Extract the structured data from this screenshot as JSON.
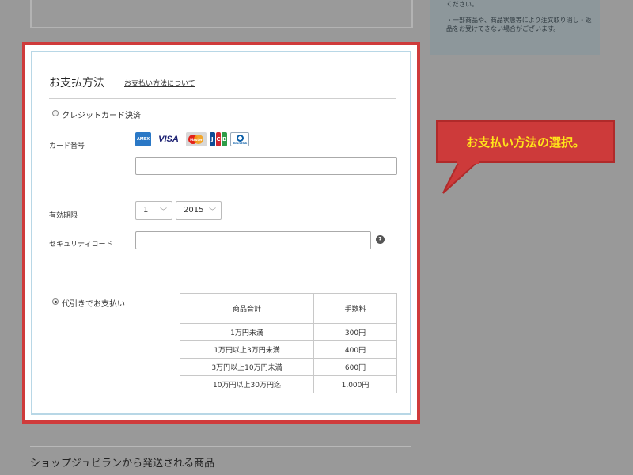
{
  "sidebar_note": {
    "line1": "ください。",
    "line2": "・一部商品や、商品状態等により注文取り消し・返品をお受けできない場合がございます。"
  },
  "payment": {
    "title": "お支払方法",
    "about_link": "お支払い方法について",
    "credit_card": {
      "option_label": "クレジットカード決済",
      "selected": false,
      "card_number_label": "カード番号",
      "card_number_value": "",
      "logos": [
        "amex-logo",
        "visa-logo",
        "mastercard-logo",
        "jcb-logo",
        "diners-logo"
      ],
      "visa_text": "VISA",
      "jcb_letters": [
        "J",
        "C",
        "B"
      ],
      "expiry_label": "有効期限",
      "expiry_month": "1",
      "expiry_year": "2015",
      "security_label": "セキュリティコード",
      "security_value": "",
      "help_glyph": "?"
    },
    "cod": {
      "option_label": "代引きでお支払い",
      "selected": true,
      "table": {
        "headers": [
          "商品合計",
          "手数料"
        ],
        "rows": [
          [
            "1万円未満",
            "300円"
          ],
          [
            "1万円以上3万円未満",
            "400円"
          ],
          [
            "3万円以上10万円未満",
            "600円"
          ],
          [
            "10万円以上30万円迄",
            "1,000円"
          ]
        ]
      }
    }
  },
  "callout": {
    "text": "お支払い方法の選択。"
  },
  "bottom_section": {
    "title": "ショップジュビランから発送される商品"
  },
  "colors": {
    "highlight_border": "#cf3b3b",
    "callout_bg": "#cd3a3a",
    "callout_text": "#ffe51a",
    "panel_inner_border": "#b8d7e6",
    "overlay": "#999999"
  }
}
